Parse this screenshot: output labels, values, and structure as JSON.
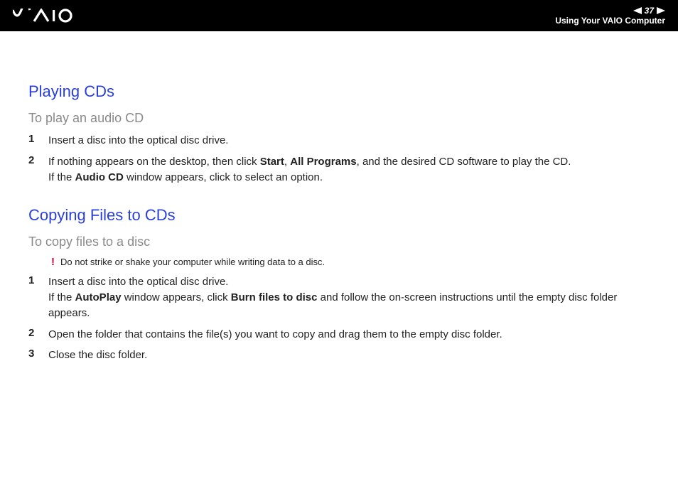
{
  "header": {
    "logo_text": "VAIO",
    "page_number": "37",
    "section_title": "Using Your VAIO Computer"
  },
  "section1": {
    "heading": "Playing CDs",
    "sub": "To play an audio CD",
    "steps": {
      "s1_num": "1",
      "s1_text": "Insert a disc into the optical disc drive.",
      "s2_num": "2",
      "s2_a": "If nothing appears on the desktop, then click ",
      "s2_start": "Start",
      "s2_c1": ", ",
      "s2_allprog": "All Programs",
      "s2_b": ", and the desired CD software to play the CD.",
      "s2_line2a": "If the ",
      "s2_audiocd": "Audio CD",
      "s2_line2b": " window appears, click to select an option."
    }
  },
  "section2": {
    "heading": "Copying Files to CDs",
    "sub": "To copy files to a disc",
    "caution_icon": "!",
    "caution_text": "Do not strike or shake your computer while writing data to a disc.",
    "steps": {
      "s1_num": "1",
      "s1_line1": "Insert a disc into the optical disc drive.",
      "s1_line2a": "If the ",
      "s1_autoplay": "AutoPlay",
      "s1_line2b": " window appears, click ",
      "s1_burn": "Burn files to disc",
      "s1_line2c": " and follow the on-screen instructions until the empty disc folder appears.",
      "s2_num": "2",
      "s2_text": "Open the folder that contains the file(s) you want to copy and drag them to the empty disc folder.",
      "s3_num": "3",
      "s3_text": "Close the disc folder."
    }
  }
}
